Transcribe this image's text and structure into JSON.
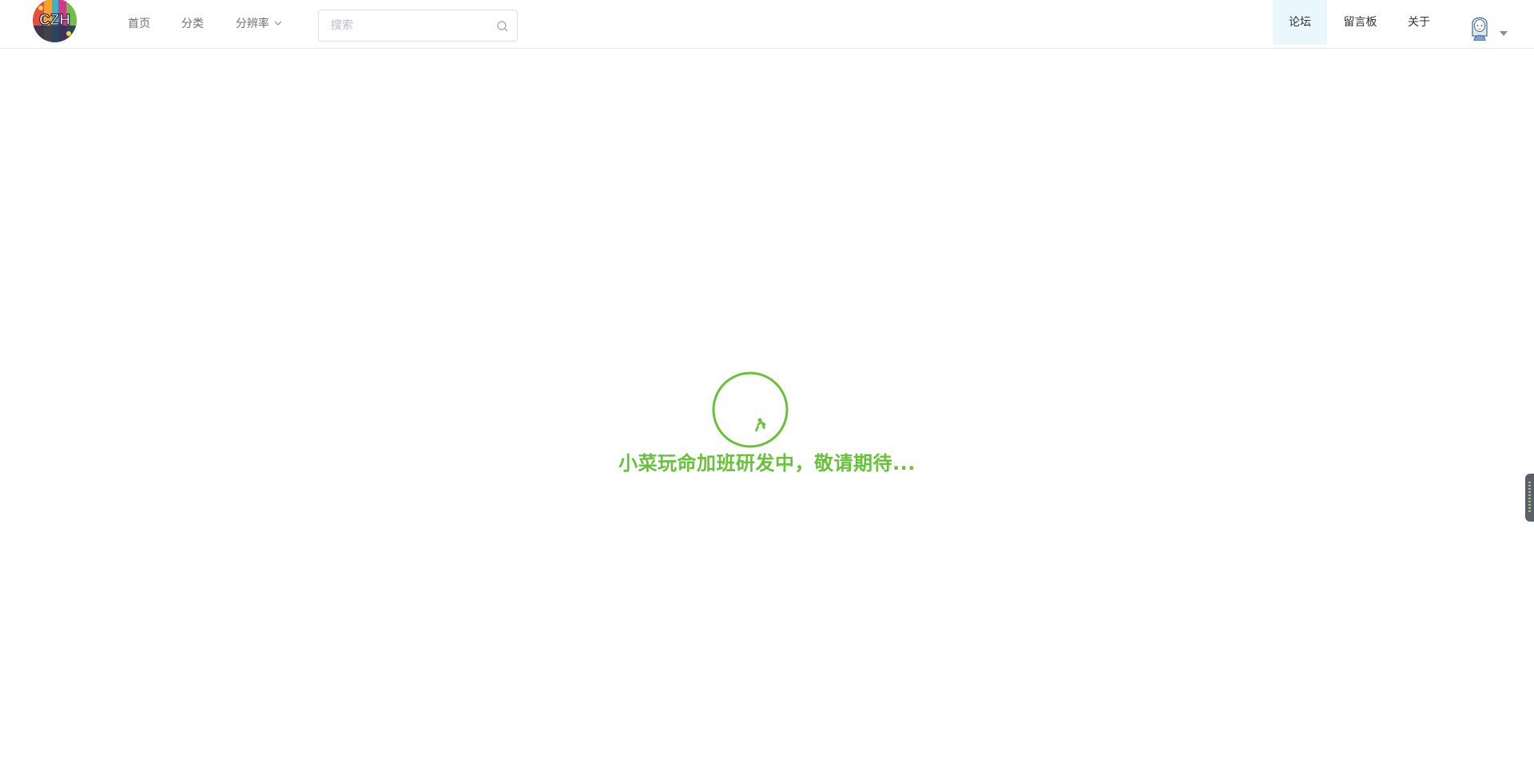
{
  "header": {
    "logo_text": "CZH",
    "nav": {
      "home": "首页",
      "category": "分类",
      "resolution": "分辨率"
    },
    "search": {
      "placeholder": "搜索",
      "value": ""
    },
    "right_nav": {
      "forum": "论坛",
      "message_board": "留言板",
      "about": "关于"
    }
  },
  "main": {
    "message": "小菜玩命加班研发中，敬请期待..."
  },
  "colors": {
    "accent_green": "#67c23a",
    "active_nav_bg": "#eaf8fd",
    "border": "#e4e7ed"
  }
}
